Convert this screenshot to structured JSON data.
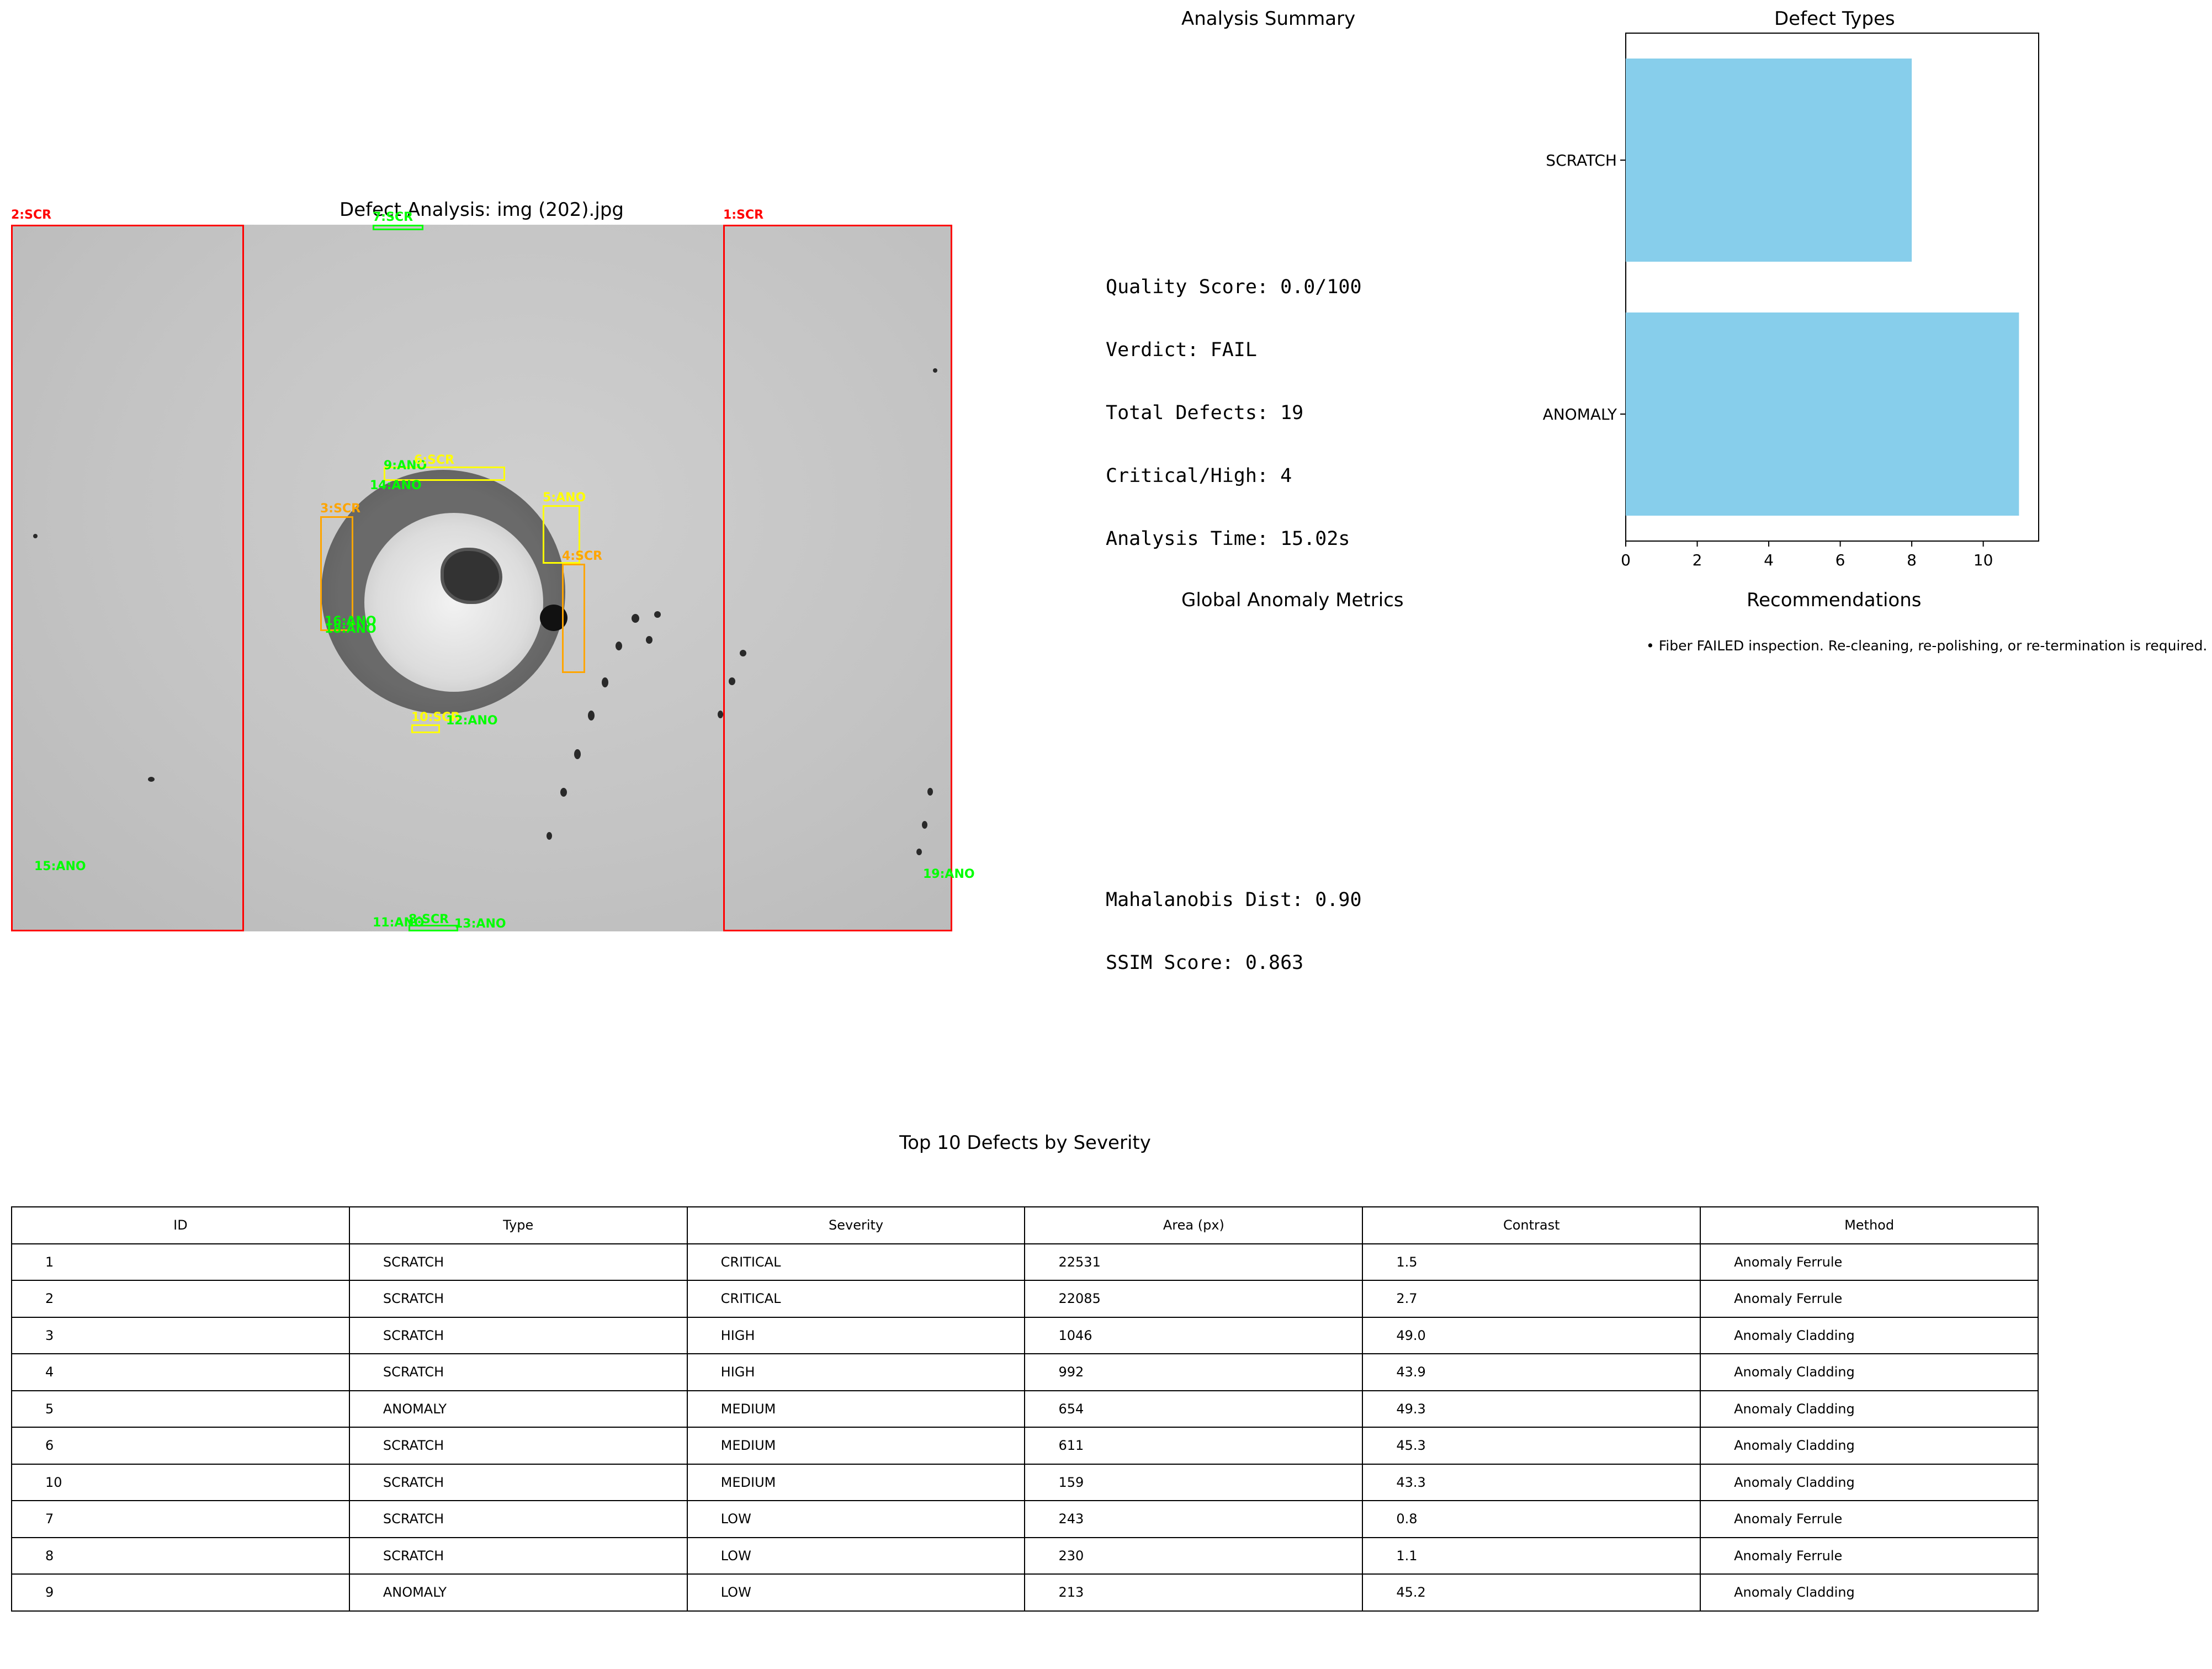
{
  "image_panel": {
    "title": "Defect Analysis: img (202).jpg",
    "annotations": [
      {
        "label": "2:SCR",
        "color": "#ff0000"
      },
      {
        "label": "1:SCR",
        "color": "#ff0000"
      },
      {
        "label": "7:SCR",
        "color": "#00ff00"
      },
      {
        "label": "9:ANO",
        "color": "#00ff00"
      },
      {
        "label": "6:SCR",
        "color": "#ffff00"
      },
      {
        "label": "14:ANO",
        "color": "#00ff00"
      },
      {
        "label": "3:SCR",
        "color": "#ffa500"
      },
      {
        "label": "5:ANO",
        "color": "#ffff00"
      },
      {
        "label": "4:SCR",
        "color": "#ffa500"
      },
      {
        "label": "16:ANO",
        "color": "#00ff00"
      },
      {
        "label": "18:ANO",
        "color": "#00ff00"
      },
      {
        "label": "10:SCR",
        "color": "#ffff00"
      },
      {
        "label": "12:ANO",
        "color": "#00ff00"
      },
      {
        "label": "15:ANO",
        "color": "#00ff00"
      },
      {
        "label": "19:ANO",
        "color": "#00ff00"
      },
      {
        "label": "11:ANO",
        "color": "#00ff00"
      },
      {
        "label": "8:SCR",
        "color": "#00ff00"
      },
      {
        "label": "13:ANO",
        "color": "#00ff00"
      }
    ]
  },
  "summary": {
    "title": "Analysis Summary",
    "lines": [
      "Quality Score: 0.0/100",
      "Verdict: FAIL",
      "Total Defects: 19",
      "Critical/High: 4",
      "Analysis Time: 15.02s"
    ]
  },
  "metrics": {
    "title": "Global Anomaly Metrics",
    "lines": [
      "Mahalanobis Dist: 0.90",
      "SSIM Score: 0.863"
    ]
  },
  "recommendations": {
    "title": "Recommendations",
    "items": [
      "• Fiber FAILED inspection. Re-cleaning, re-polishing, or re-termination is required."
    ]
  },
  "chart_data": {
    "type": "bar",
    "orientation": "horizontal",
    "title": "Defect Types",
    "categories": [
      "ANOMALY",
      "SCRATCH"
    ],
    "values": [
      11,
      8
    ],
    "xlim": [
      0,
      11.55
    ],
    "xticks": [
      "0",
      "2",
      "4",
      "6",
      "8",
      "10"
    ],
    "bar_color": "#87ceeb"
  },
  "table": {
    "title": "Top 10 Defects by Severity",
    "columns": [
      "ID",
      "Type",
      "Severity",
      "Area (px)",
      "Contrast",
      "Method"
    ],
    "rows": [
      [
        "1",
        "SCRATCH",
        "CRITICAL",
        "22531",
        "1.5",
        "Anomaly Ferrule"
      ],
      [
        "2",
        "SCRATCH",
        "CRITICAL",
        "22085",
        "2.7",
        "Anomaly Ferrule"
      ],
      [
        "3",
        "SCRATCH",
        "HIGH",
        "1046",
        "49.0",
        "Anomaly Cladding"
      ],
      [
        "4",
        "SCRATCH",
        "HIGH",
        "992",
        "43.9",
        "Anomaly Cladding"
      ],
      [
        "5",
        "ANOMALY",
        "MEDIUM",
        "654",
        "49.3",
        "Anomaly Cladding"
      ],
      [
        "6",
        "SCRATCH",
        "MEDIUM",
        "611",
        "45.3",
        "Anomaly Cladding"
      ],
      [
        "10",
        "SCRATCH",
        "MEDIUM",
        "159",
        "43.3",
        "Anomaly Cladding"
      ],
      [
        "7",
        "SCRATCH",
        "LOW",
        "243",
        "0.8",
        "Anomaly Ferrule"
      ],
      [
        "8",
        "SCRATCH",
        "LOW",
        "230",
        "1.1",
        "Anomaly Ferrule"
      ],
      [
        "9",
        "ANOMALY",
        "LOW",
        "213",
        "45.2",
        "Anomaly Cladding"
      ]
    ]
  }
}
